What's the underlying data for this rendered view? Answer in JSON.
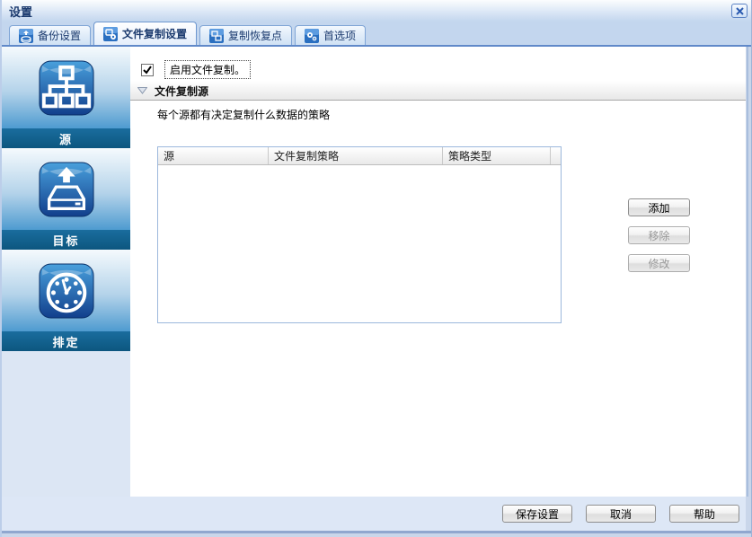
{
  "window": {
    "title": "设置"
  },
  "tabs": [
    {
      "label": "备份设置",
      "active": false
    },
    {
      "label": "文件复制设置",
      "active": true
    },
    {
      "label": "复制恢复点",
      "active": false
    },
    {
      "label": "首选项",
      "active": false
    }
  ],
  "sidebar": {
    "items": [
      {
        "label": "源",
        "icon": "network-source-icon"
      },
      {
        "label": "目标",
        "icon": "destination-drive-icon"
      },
      {
        "label": "排定",
        "icon": "schedule-clock-icon"
      }
    ]
  },
  "main": {
    "enable_checkbox": {
      "label": "启用文件复制。",
      "checked": true
    },
    "section": {
      "title": "文件复制源"
    },
    "description": "每个源都有决定复制什么数据的策略",
    "table": {
      "columns": [
        "源",
        "文件复制策略",
        "策略类型"
      ],
      "rows": []
    },
    "actions": [
      {
        "label": "添加",
        "enabled": true
      },
      {
        "label": "移除",
        "enabled": false
      },
      {
        "label": "修改",
        "enabled": false
      }
    ]
  },
  "footer": {
    "buttons": [
      {
        "label": "保存设置"
      },
      {
        "label": "取消"
      },
      {
        "label": "帮助"
      }
    ]
  },
  "colors": {
    "accent_bar": "#0c567f",
    "tab_text": "#1b3a6e",
    "table_border": "#9cb8dc",
    "footer_bg": "#dde7f6"
  }
}
